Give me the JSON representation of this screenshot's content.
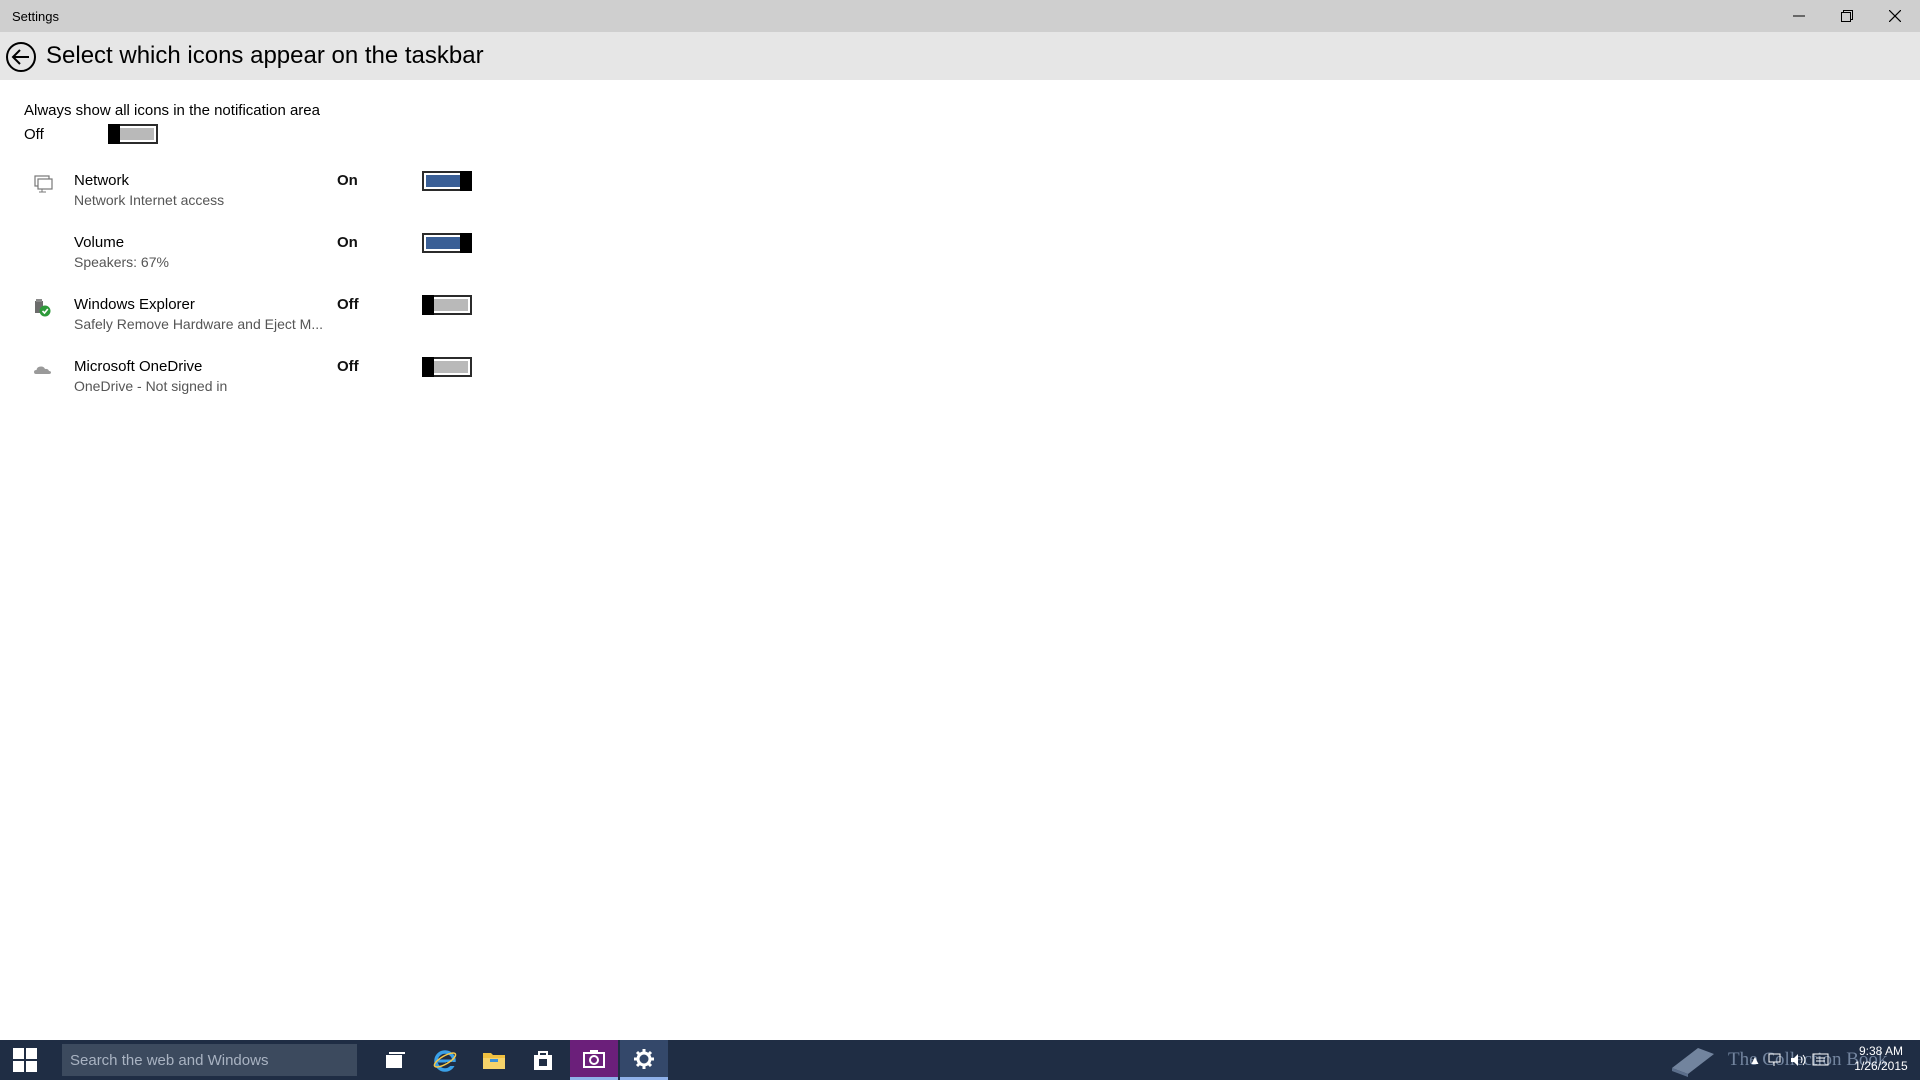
{
  "window": {
    "title": "Settings"
  },
  "header": {
    "title": "Select which icons appear on the taskbar"
  },
  "master": {
    "label": "Always show all icons in the notification area",
    "state": "Off",
    "on": false
  },
  "rows": [
    {
      "name": "Network",
      "subtitle": "Network Internet access",
      "state": "On",
      "on": true,
      "icon": "network-icon"
    },
    {
      "name": "Volume",
      "subtitle": "Speakers: 67%",
      "state": "On",
      "on": true,
      "icon": "none"
    },
    {
      "name": "Windows Explorer",
      "subtitle": "Safely Remove Hardware and Eject M...",
      "state": "Off",
      "on": false,
      "icon": "safely-remove-hardware-icon"
    },
    {
      "name": "Microsoft OneDrive",
      "subtitle": "OneDrive - Not signed in",
      "state": "Off",
      "on": false,
      "icon": "onedrive-cloud-icon"
    }
  ],
  "taskbar": {
    "search_placeholder": "Search the web and Windows",
    "apps": [
      "task-view",
      "internet-explorer",
      "file-explorer",
      "store",
      "camera",
      "settings"
    ],
    "watermark": "The Collection Book",
    "clock_time": "9:38 AM",
    "clock_date": "1/26/2015"
  },
  "colors": {
    "toggle_on": "#3a5f96",
    "toggle_off": "#b9b9b9",
    "taskbar": "#1f2d44",
    "header": "#e6e6e6",
    "titlebar": "#cfcfcf"
  }
}
